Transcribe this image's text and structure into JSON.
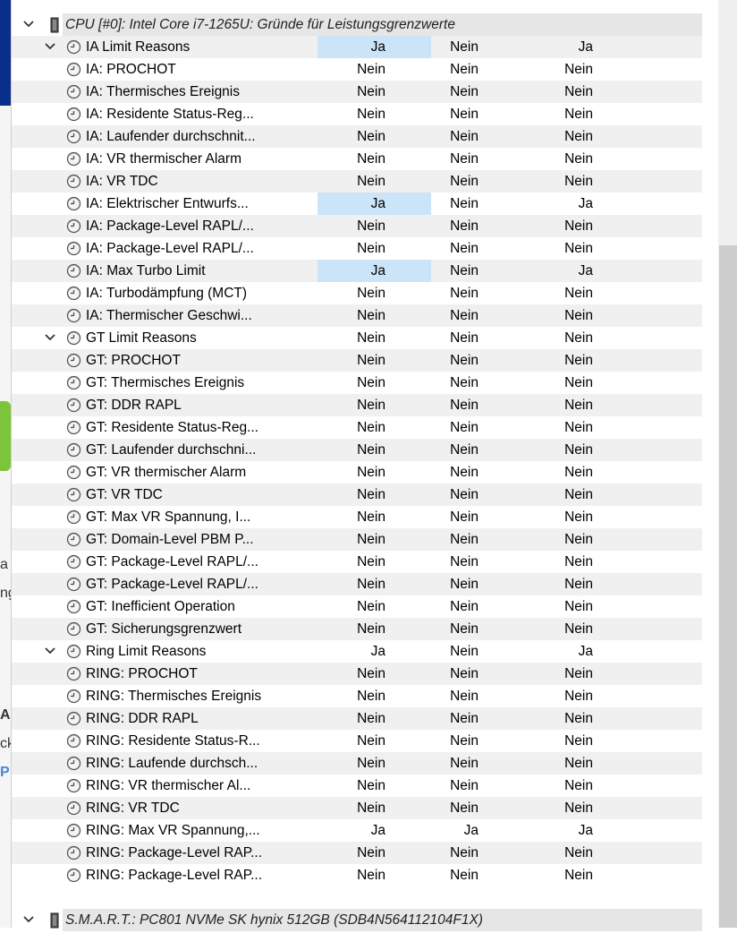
{
  "background_fragments": [
    "a",
    "ng",
    "A",
    "ck",
    "P"
  ],
  "colors": {
    "row_alt": "#f0f0f0",
    "highlight": "#cce4f7",
    "header_bg": "#e6e6e6"
  },
  "cpu_header": {
    "title": "CPU [#0]: Intel Core i7-1265U: Gründe für Leistungsgrenzwerte",
    "expanded": true
  },
  "rows": [
    {
      "indent": 1,
      "group": true,
      "label": "IA Limit Reasons",
      "values": [
        "Ja",
        "Nein",
        "Ja"
      ],
      "highlight": true
    },
    {
      "indent": 2,
      "group": false,
      "label": "IA: PROCHOT",
      "values": [
        "Nein",
        "Nein",
        "Nein"
      ],
      "highlight": false
    },
    {
      "indent": 2,
      "group": false,
      "label": "IA: Thermisches Ereignis",
      "values": [
        "Nein",
        "Nein",
        "Nein"
      ],
      "highlight": false
    },
    {
      "indent": 2,
      "group": false,
      "label": "IA: Residente Status-Reg...",
      "values": [
        "Nein",
        "Nein",
        "Nein"
      ],
      "highlight": false
    },
    {
      "indent": 2,
      "group": false,
      "label": "IA: Laufender durchschnit...",
      "values": [
        "Nein",
        "Nein",
        "Nein"
      ],
      "highlight": false
    },
    {
      "indent": 2,
      "group": false,
      "label": "IA: VR thermischer Alarm",
      "values": [
        "Nein",
        "Nein",
        "Nein"
      ],
      "highlight": false
    },
    {
      "indent": 2,
      "group": false,
      "label": "IA: VR TDC",
      "values": [
        "Nein",
        "Nein",
        "Nein"
      ],
      "highlight": false
    },
    {
      "indent": 2,
      "group": false,
      "label": "IA: Elektrischer Entwurfs...",
      "values": [
        "Ja",
        "Nein",
        "Ja"
      ],
      "highlight": true
    },
    {
      "indent": 2,
      "group": false,
      "label": "IA: Package-Level RAPL/...",
      "values": [
        "Nein",
        "Nein",
        "Nein"
      ],
      "highlight": false
    },
    {
      "indent": 2,
      "group": false,
      "label": "IA: Package-Level RAPL/...",
      "values": [
        "Nein",
        "Nein",
        "Nein"
      ],
      "highlight": false
    },
    {
      "indent": 2,
      "group": false,
      "label": "IA: Max Turbo Limit",
      "values": [
        "Ja",
        "Nein",
        "Ja"
      ],
      "highlight": true
    },
    {
      "indent": 2,
      "group": false,
      "label": "IA: Turbodämpfung (MCT)",
      "values": [
        "Nein",
        "Nein",
        "Nein"
      ],
      "highlight": false
    },
    {
      "indent": 2,
      "group": false,
      "label": "IA: Thermischer Geschwi...",
      "values": [
        "Nein",
        "Nein",
        "Nein"
      ],
      "highlight": false
    },
    {
      "indent": 1,
      "group": true,
      "label": "GT Limit Reasons",
      "values": [
        "Nein",
        "Nein",
        "Nein"
      ],
      "highlight": false
    },
    {
      "indent": 2,
      "group": false,
      "label": "GT: PROCHOT",
      "values": [
        "Nein",
        "Nein",
        "Nein"
      ],
      "highlight": false
    },
    {
      "indent": 2,
      "group": false,
      "label": "GT: Thermisches Ereignis",
      "values": [
        "Nein",
        "Nein",
        "Nein"
      ],
      "highlight": false
    },
    {
      "indent": 2,
      "group": false,
      "label": "GT: DDR RAPL",
      "values": [
        "Nein",
        "Nein",
        "Nein"
      ],
      "highlight": false
    },
    {
      "indent": 2,
      "group": false,
      "label": "GT: Residente Status-Reg...",
      "values": [
        "Nein",
        "Nein",
        "Nein"
      ],
      "highlight": false
    },
    {
      "indent": 2,
      "group": false,
      "label": "GT: Laufender durchschni...",
      "values": [
        "Nein",
        "Nein",
        "Nein"
      ],
      "highlight": false
    },
    {
      "indent": 2,
      "group": false,
      "label": "GT: VR thermischer Alarm",
      "values": [
        "Nein",
        "Nein",
        "Nein"
      ],
      "highlight": false
    },
    {
      "indent": 2,
      "group": false,
      "label": "GT: VR TDC",
      "values": [
        "Nein",
        "Nein",
        "Nein"
      ],
      "highlight": false
    },
    {
      "indent": 2,
      "group": false,
      "label": "GT: Max VR Spannung, I...",
      "values": [
        "Nein",
        "Nein",
        "Nein"
      ],
      "highlight": false
    },
    {
      "indent": 2,
      "group": false,
      "label": "GT: Domain-Level PBM P...",
      "values": [
        "Nein",
        "Nein",
        "Nein"
      ],
      "highlight": false
    },
    {
      "indent": 2,
      "group": false,
      "label": "GT: Package-Level RAPL/...",
      "values": [
        "Nein",
        "Nein",
        "Nein"
      ],
      "highlight": false
    },
    {
      "indent": 2,
      "group": false,
      "label": "GT: Package-Level RAPL/...",
      "values": [
        "Nein",
        "Nein",
        "Nein"
      ],
      "highlight": false
    },
    {
      "indent": 2,
      "group": false,
      "label": "GT: Inefficient Operation",
      "values": [
        "Nein",
        "Nein",
        "Nein"
      ],
      "highlight": false
    },
    {
      "indent": 2,
      "group": false,
      "label": "GT: Sicherungsgrenzwert",
      "values": [
        "Nein",
        "Nein",
        "Nein"
      ],
      "highlight": false
    },
    {
      "indent": 1,
      "group": true,
      "label": "Ring Limit Reasons",
      "values": [
        "Ja",
        "Nein",
        "Ja"
      ],
      "highlight": false
    },
    {
      "indent": 2,
      "group": false,
      "label": "RING: PROCHOT",
      "values": [
        "Nein",
        "Nein",
        "Nein"
      ],
      "highlight": false
    },
    {
      "indent": 2,
      "group": false,
      "label": "RING: Thermisches Ereignis",
      "values": [
        "Nein",
        "Nein",
        "Nein"
      ],
      "highlight": false
    },
    {
      "indent": 2,
      "group": false,
      "label": "RING: DDR RAPL",
      "values": [
        "Nein",
        "Nein",
        "Nein"
      ],
      "highlight": false
    },
    {
      "indent": 2,
      "group": false,
      "label": "RING: Residente Status-R...",
      "values": [
        "Nein",
        "Nein",
        "Nein"
      ],
      "highlight": false
    },
    {
      "indent": 2,
      "group": false,
      "label": "RING: Laufende durchsch...",
      "values": [
        "Nein",
        "Nein",
        "Nein"
      ],
      "highlight": false
    },
    {
      "indent": 2,
      "group": false,
      "label": "RING: VR thermischer Al...",
      "values": [
        "Nein",
        "Nein",
        "Nein"
      ],
      "highlight": false
    },
    {
      "indent": 2,
      "group": false,
      "label": "RING: VR TDC",
      "values": [
        "Nein",
        "Nein",
        "Nein"
      ],
      "highlight": false
    },
    {
      "indent": 2,
      "group": false,
      "label": "RING: Max VR Spannung,...",
      "values": [
        "Ja",
        "Ja",
        "Ja"
      ],
      "highlight": false
    },
    {
      "indent": 2,
      "group": false,
      "label": "RING: Package-Level RAP...",
      "values": [
        "Nein",
        "Nein",
        "Nein"
      ],
      "highlight": false
    },
    {
      "indent": 2,
      "group": false,
      "label": "RING: Package-Level RAP...",
      "values": [
        "Nein",
        "Nein",
        "Nein"
      ],
      "highlight": false
    }
  ],
  "smart_header": {
    "title": "S.M.A.R.T.: PC801 NVMe SK hynix 512GB (SDB4N564112104F1X)",
    "expanded": true
  }
}
